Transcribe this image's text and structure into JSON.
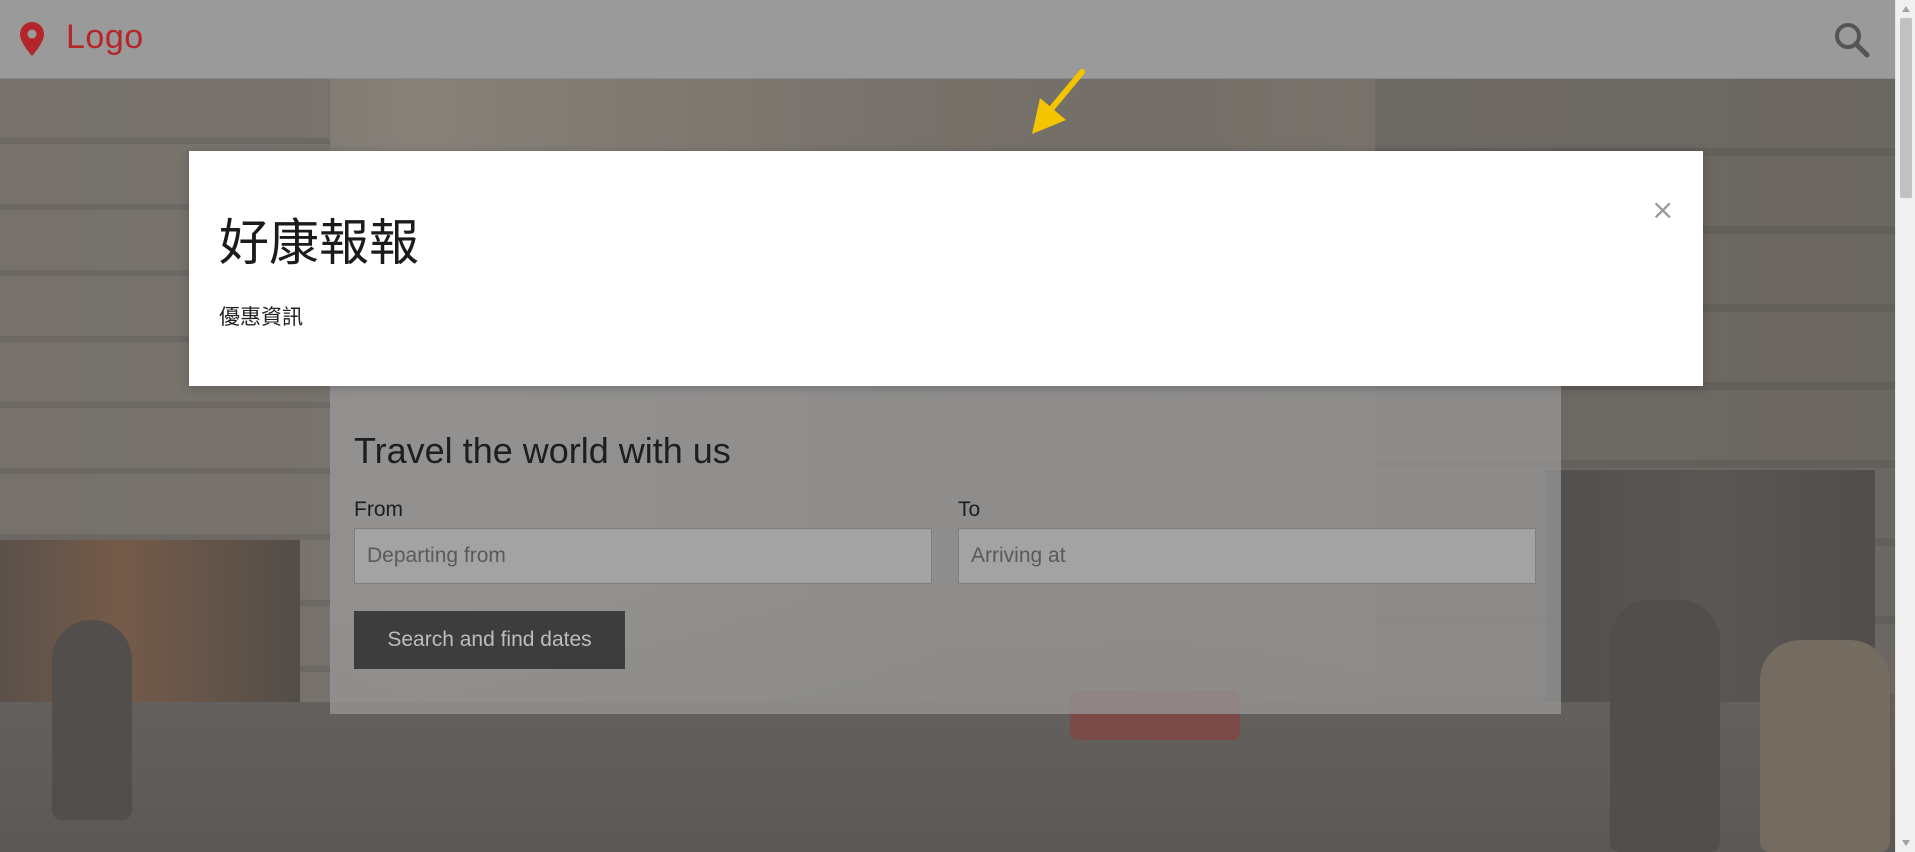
{
  "header": {
    "logo_text": "Logo",
    "logo_icon": "map-pin-icon",
    "search_icon": "search-icon",
    "logo_color": "#b5262a"
  },
  "search_panel": {
    "title": "Travel the world with us",
    "from_label": "From",
    "from_placeholder": "Departing from",
    "to_label": "To",
    "to_placeholder": "Arriving at",
    "submit_label": "Search and find dates"
  },
  "modal": {
    "title": "好康報報",
    "body": "優惠資訊",
    "close_label": "×"
  },
  "annotation": {
    "arrow_icon": "arrow-pointer-icon",
    "arrow_color": "#f5c400"
  }
}
